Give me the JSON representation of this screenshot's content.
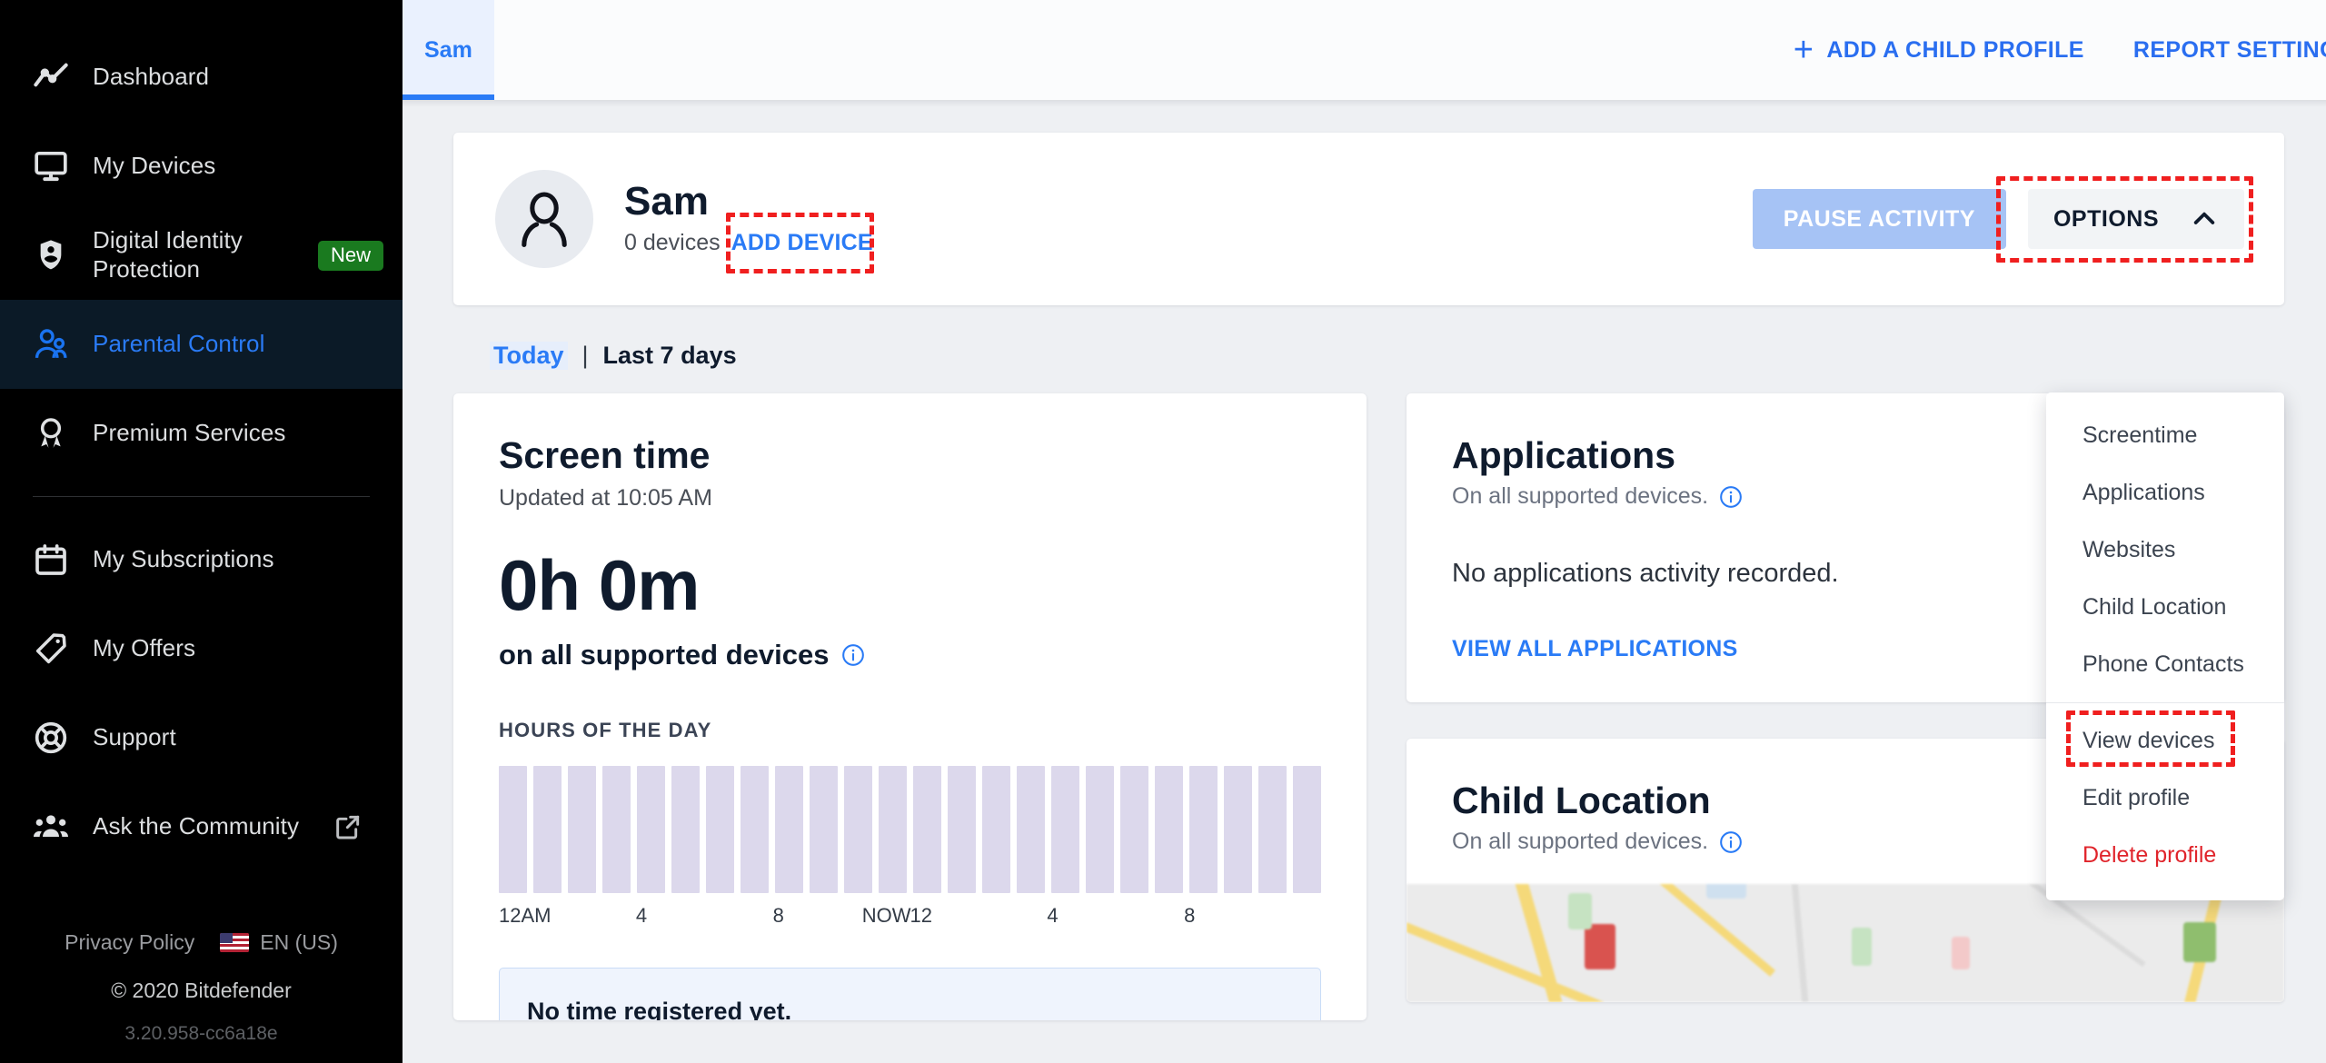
{
  "sidebar": {
    "items": [
      {
        "label": "Dashboard",
        "icon": "activity-chart-icon",
        "active": false,
        "badge": null
      },
      {
        "label": "My Devices",
        "icon": "monitor-icon",
        "active": false,
        "badge": null
      },
      {
        "label": "Digital Identity Protection",
        "icon": "shield-person-icon",
        "active": false,
        "badge": "New"
      },
      {
        "label": "Parental Control",
        "icon": "parental-control-icon",
        "active": true,
        "badge": null
      },
      {
        "label": "Premium Services",
        "icon": "award-ribbon-icon",
        "active": false,
        "badge": null
      },
      {
        "label": "My Subscriptions",
        "icon": "calendar-icon",
        "active": false,
        "badge": null
      },
      {
        "label": "My Offers",
        "icon": "price-tag-icon",
        "active": false,
        "badge": null
      },
      {
        "label": "Support",
        "icon": "life-ring-icon",
        "active": false,
        "badge": null
      },
      {
        "label": "Ask the Community",
        "icon": "people-group-icon",
        "active": false,
        "badge": null,
        "external": true
      }
    ],
    "footer": {
      "privacy_policy": "Privacy Policy",
      "language": "EN (US)",
      "copyright": "© 2020 Bitdefender",
      "version": "3.20.958-cc6a18e"
    }
  },
  "topbar": {
    "tabs": [
      {
        "label": "Sam",
        "active": true
      }
    ],
    "add_child_profile": "ADD A CHILD PROFILE",
    "report_settings": "REPORT SETTINGS"
  },
  "profile": {
    "name": "Sam",
    "devices": "0 devices",
    "add_device": "ADD DEVICE",
    "pause_activity": "PAUSE ACTIVITY",
    "options": "OPTIONS"
  },
  "options_menu": {
    "items": [
      {
        "label": "Screentime",
        "danger": false,
        "highlighted": false
      },
      {
        "label": "Applications",
        "danger": false,
        "highlighted": false
      },
      {
        "label": "Websites",
        "danger": false,
        "highlighted": false
      },
      {
        "label": "Child Location",
        "danger": false,
        "highlighted": false
      },
      {
        "label": "Phone Contacts",
        "danger": false,
        "highlighted": false
      },
      {
        "label": "View devices",
        "danger": false,
        "highlighted": true
      },
      {
        "label": "Edit profile",
        "danger": false,
        "highlighted": false
      },
      {
        "label": "Delete profile",
        "danger": true,
        "highlighted": false
      }
    ]
  },
  "periods": {
    "today": "Today",
    "separator": "|",
    "last7": "Last 7 days"
  },
  "screen_time": {
    "title": "Screen time",
    "updated": "Updated at 10:05 AM",
    "value": "0h 0m",
    "supported": "on all supported devices",
    "hours_label": "HOURS OF THE DAY",
    "notice": "No time registered yet."
  },
  "applications": {
    "title": "Applications",
    "subtitle": "On all supported devices.",
    "empty": "No applications activity recorded.",
    "view_all": "VIEW ALL APPLICATIONS"
  },
  "child_location": {
    "title": "Child Location",
    "subtitle": "On all supported devices."
  },
  "chart_data": {
    "type": "bar",
    "title": "HOURS OF THE DAY",
    "categories": [
      "0",
      "1",
      "2",
      "3",
      "4",
      "5",
      "6",
      "7",
      "8",
      "9",
      "10",
      "11",
      "12",
      "13",
      "14",
      "15",
      "16",
      "17",
      "18",
      "19",
      "20",
      "21",
      "22",
      "23"
    ],
    "values": [
      0,
      0,
      0,
      0,
      0,
      0,
      0,
      0,
      0,
      0,
      0,
      0,
      0,
      0,
      0,
      0,
      0,
      0,
      0,
      0,
      0,
      0,
      0,
      0
    ],
    "tick_labels": [
      {
        "label": "12AM",
        "index": 0
      },
      {
        "label": "4",
        "index": 4
      },
      {
        "label": "8",
        "index": 8
      },
      {
        "label": "NOW",
        "index": 10.6
      },
      {
        "label": "12",
        "index": 12
      },
      {
        "label": "4",
        "index": 16
      },
      {
        "label": "8",
        "index": 20
      }
    ],
    "xlabel": "",
    "ylabel": "",
    "grid": false,
    "bar_color": "#dcd8ec"
  },
  "colors": {
    "accent_blue": "#2a7bf6",
    "sidebar_bg": "#000000",
    "sidebar_active_bg": "#0b1a27",
    "badge_green": "#1a7a1f",
    "danger_red": "#e0242b",
    "highlight_red": "#f01f1f",
    "bar_lavender": "#dcd8ec"
  }
}
